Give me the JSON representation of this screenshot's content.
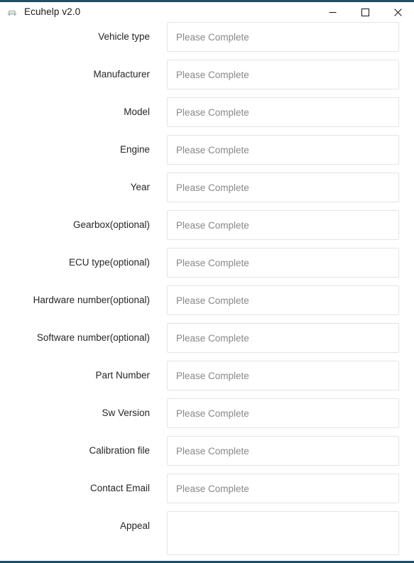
{
  "window": {
    "title": "Ecuhelp v2.0",
    "icon": "car-app-icon",
    "accent_color": "#1b5067",
    "background_color": "#ffffff",
    "border_color": "#e4e4e4",
    "label_color": "#262626",
    "placeholder_color": "#888888",
    "controls": {
      "minimize": "minimize-icon",
      "maximize": "maximize-icon",
      "close": "close-icon"
    }
  },
  "form": {
    "placeholder": "Please Complete",
    "fields": [
      {
        "label": "Vehicle type",
        "value": "",
        "placeholder": "Please Complete",
        "type": "text"
      },
      {
        "label": "Manufacturer",
        "value": "",
        "placeholder": "Please Complete",
        "type": "text"
      },
      {
        "label": "Model",
        "value": "",
        "placeholder": "Please Complete",
        "type": "text"
      },
      {
        "label": "Engine",
        "value": "",
        "placeholder": "Please Complete",
        "type": "text"
      },
      {
        "label": "Year",
        "value": "",
        "placeholder": "Please Complete",
        "type": "text"
      },
      {
        "label": "Gearbox(optional)",
        "value": "",
        "placeholder": "Please Complete",
        "type": "text"
      },
      {
        "label": "ECU type(optional)",
        "value": "",
        "placeholder": "Please Complete",
        "type": "text"
      },
      {
        "label": "Hardware number(optional)",
        "value": "",
        "placeholder": "Please Complete",
        "type": "text"
      },
      {
        "label": "Software number(optional)",
        "value": "",
        "placeholder": "Please Complete",
        "type": "text"
      },
      {
        "label": "Part Number",
        "value": "",
        "placeholder": "Please Complete",
        "type": "text"
      },
      {
        "label": "Sw Version",
        "value": "",
        "placeholder": "Please Complete",
        "type": "text"
      },
      {
        "label": "Calibration file",
        "value": "",
        "placeholder": "Please Complete",
        "type": "text"
      },
      {
        "label": "Contact Email",
        "value": "",
        "placeholder": "Please Complete",
        "type": "text"
      },
      {
        "label": "Appeal",
        "value": "",
        "placeholder": "",
        "type": "textarea"
      }
    ]
  }
}
